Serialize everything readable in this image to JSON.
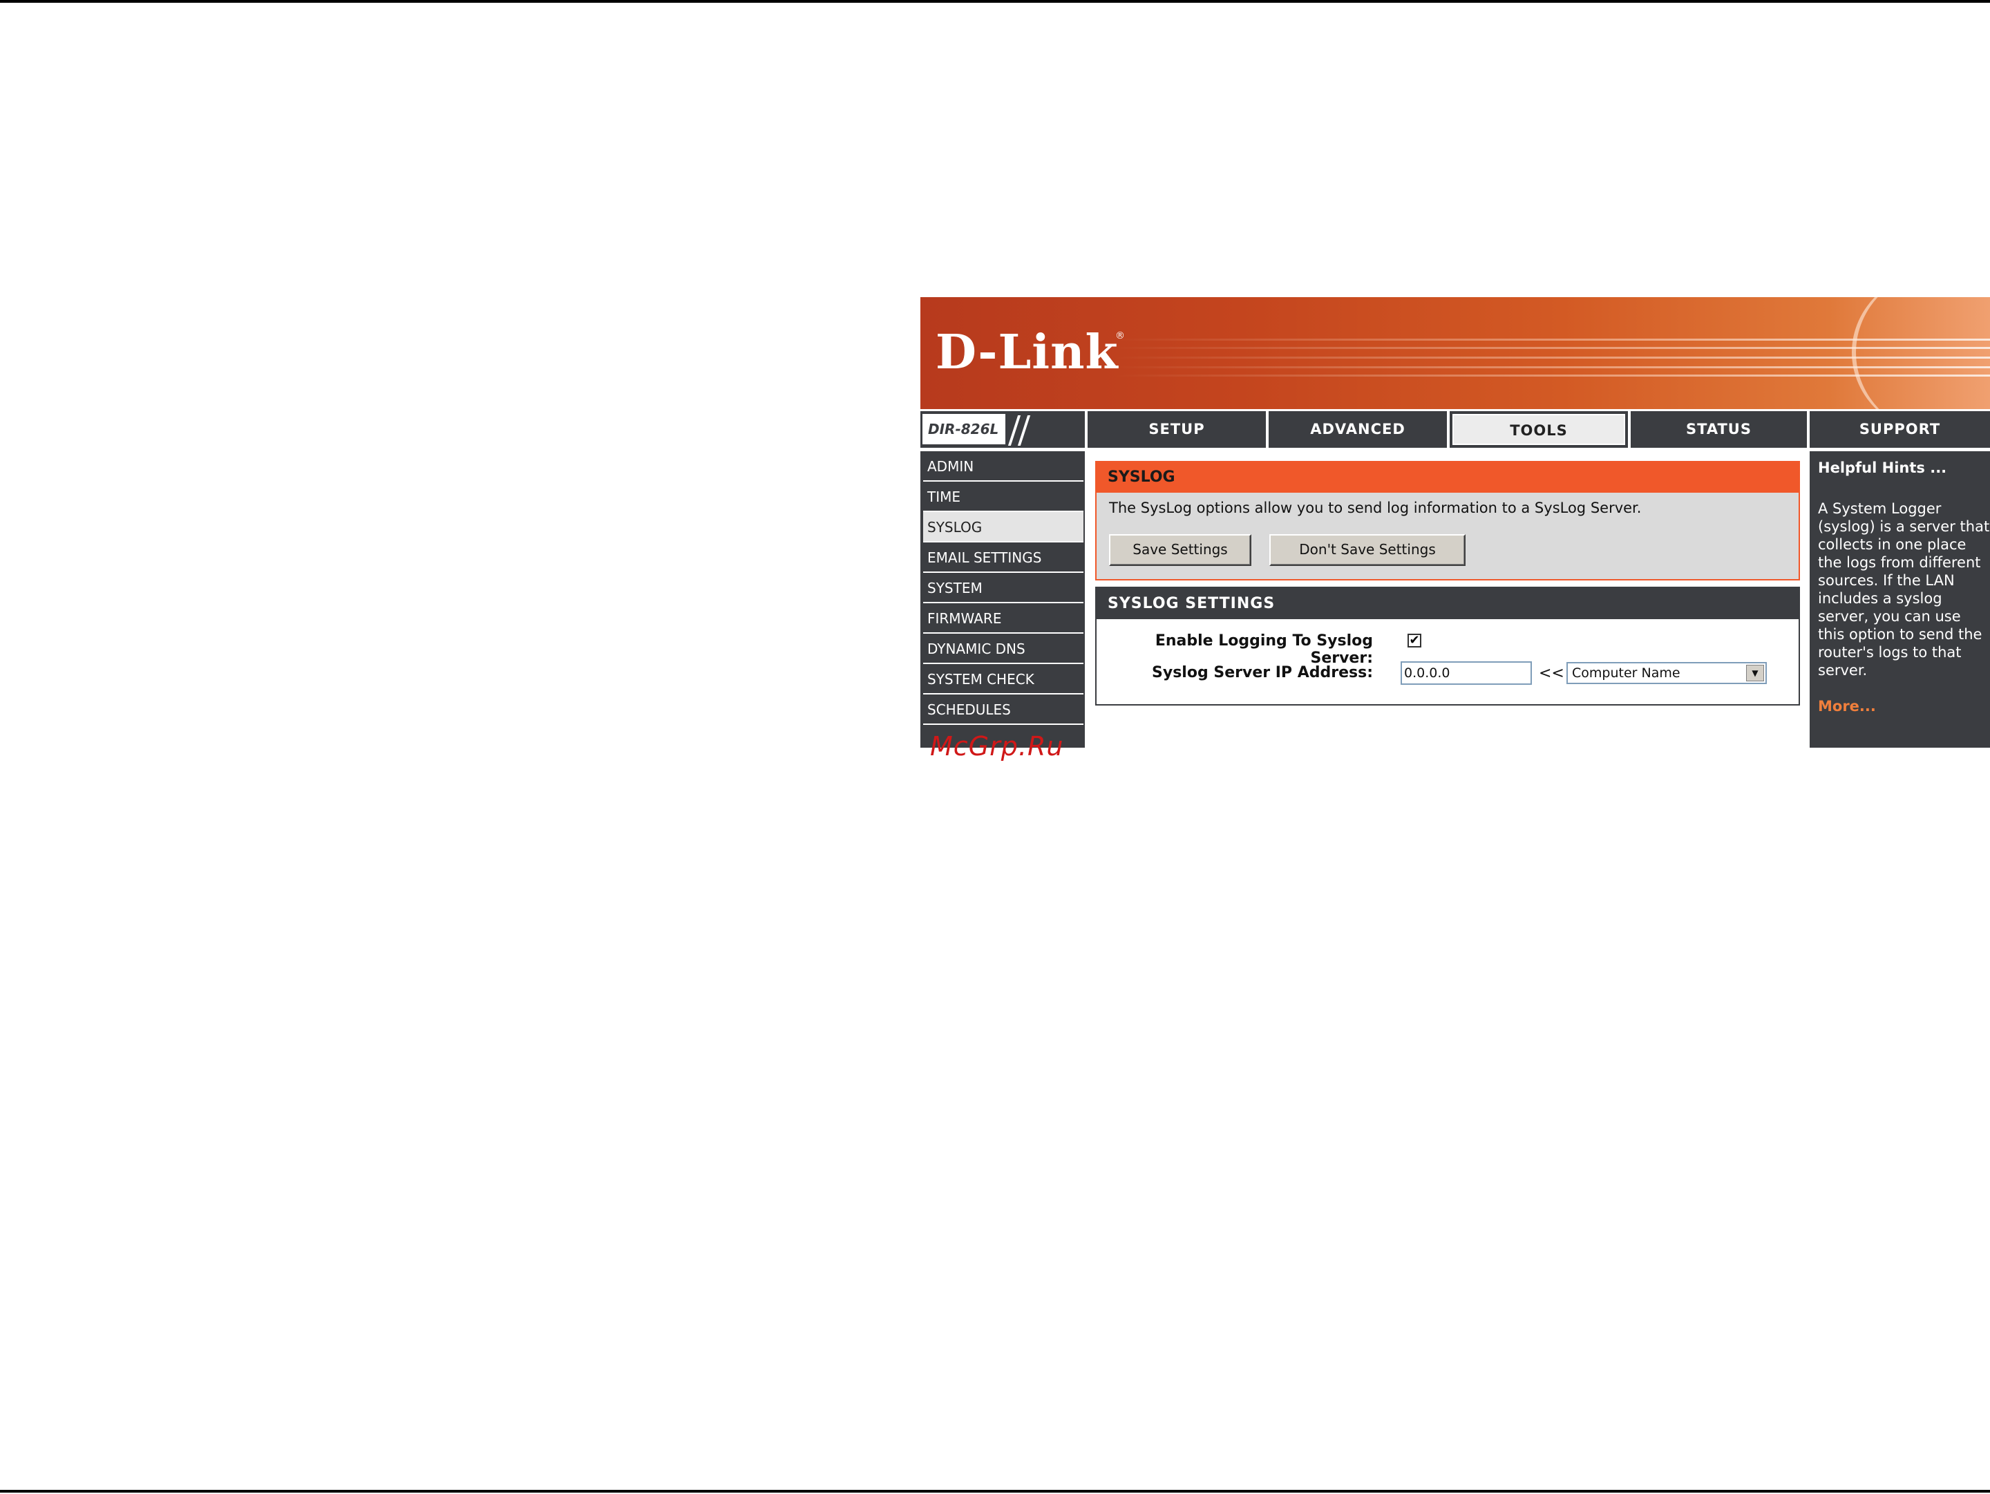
{
  "brand": {
    "logo_text": "D-Link",
    "registered_mark": "®",
    "model": "DIR-826L"
  },
  "nav": {
    "tabs": [
      {
        "label": "SETUP",
        "active": false
      },
      {
        "label": "ADVANCED",
        "active": false
      },
      {
        "label": "TOOLS",
        "active": true
      },
      {
        "label": "STATUS",
        "active": false
      },
      {
        "label": "SUPPORT",
        "active": false
      }
    ]
  },
  "sidebar": {
    "items": [
      {
        "label": "ADMIN"
      },
      {
        "label": "TIME"
      },
      {
        "label": "SYSLOG",
        "active": true
      },
      {
        "label": "EMAIL SETTINGS"
      },
      {
        "label": "SYSTEM"
      },
      {
        "label": "FIRMWARE"
      },
      {
        "label": "DYNAMIC DNS"
      },
      {
        "label": "SYSTEM CHECK"
      },
      {
        "label": "SCHEDULES"
      }
    ]
  },
  "syslog": {
    "title": "SYSLOG",
    "description": "The SysLog options allow you to send log information to a SysLog Server.",
    "save_button": "Save Settings",
    "dont_save_button": "Don't Save Settings"
  },
  "settings": {
    "title": "SYSLOG SETTINGS",
    "enable_label": "Enable Logging To Syslog Server:",
    "enable_checked": true,
    "check_mark": "✔",
    "ip_label": "Syslog Server IP Address:",
    "ip_value": "0.0.0.0",
    "copy_chevron": "<<",
    "computer_select": "Computer Name",
    "select_arrow": "▼"
  },
  "hints": {
    "title": "Helpful Hints ...",
    "body": "A System Logger (syslog) is a server that collects in one place the logs from different sources. If the LAN includes a syslog server, you can use this option to send the router's logs to that server.",
    "more": "More..."
  },
  "watermark": "McGrp.Ru",
  "colors": {
    "accent_orange": "#f0582a",
    "dark_gray": "#3b3d41",
    "more_link": "#f07f3c",
    "watermark": "#d01818"
  }
}
